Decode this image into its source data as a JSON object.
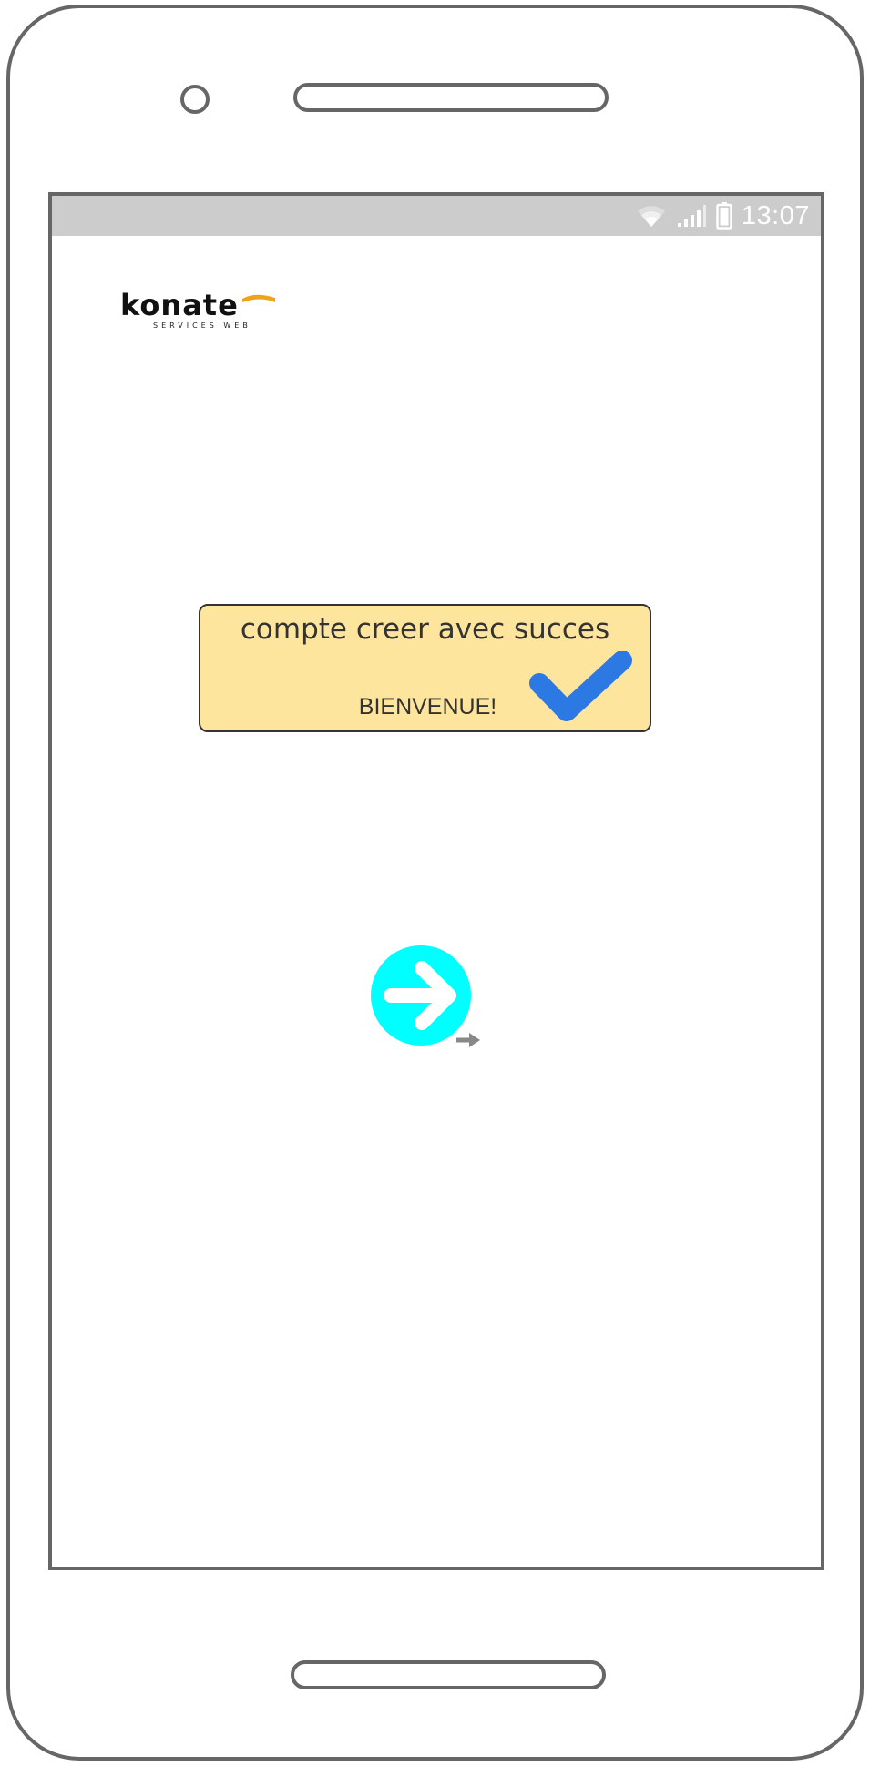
{
  "status_bar": {
    "time": "13:07",
    "icons": [
      "wifi-icon",
      "signal-icon",
      "battery-icon"
    ]
  },
  "logo": {
    "name": "konate",
    "tagline": "SERVICES WEB",
    "accent_color": "#f0a21a"
  },
  "alert": {
    "title": "compte creer avec  succes",
    "subtitle": "BIENVENUE!",
    "icon": "checkmark-icon",
    "background_color": "#fee59e",
    "check_color": "#2d79e3"
  },
  "next_button": {
    "icon": "arrow-right-icon",
    "color": "#00ffff"
  },
  "link_indicator": {
    "icon": "link-arrow-icon"
  }
}
